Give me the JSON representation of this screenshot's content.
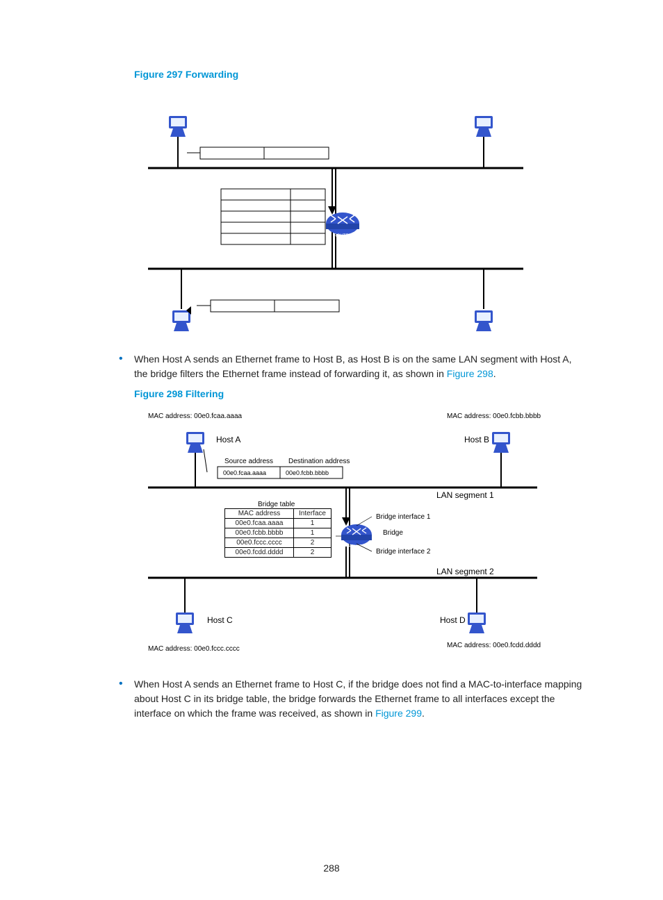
{
  "figure297": {
    "title": "Figure 297 Forwarding"
  },
  "para1": {
    "text_a": "When Host A sends an Ethernet frame to Host B, as Host B is on the same LAN segment with Host A, the bridge filters the Ethernet frame instead of forwarding it, as shown in ",
    "link": "Figure 298",
    "tail": "."
  },
  "figure298": {
    "title": "Figure 298 Filtering",
    "hostA_mac_label": "MAC address: 00e0.fcaa.aaaa",
    "hostA": "Host A",
    "hostB_mac_label": "MAC address: 00e0.fcbb.bbbb",
    "hostB": "Host B",
    "src_label": "Source address",
    "dst_label": "Destination address",
    "src_mac": "00e0.fcaa.aaaa",
    "dst_mac": "00e0.fcbb.bbbb",
    "lan1": "LAN segment 1",
    "lan2": "LAN segment 2",
    "bridge_table_label": "Bridge table",
    "col_mac": "MAC address",
    "col_if": "Interface",
    "rows": [
      {
        "mac": "00e0.fcaa.aaaa",
        "if": "1"
      },
      {
        "mac": "00e0.fcbb.bbbb",
        "if": "1"
      },
      {
        "mac": "00e0.fccc.cccc",
        "if": "2"
      },
      {
        "mac": "00e0.fcdd.dddd",
        "if": "2"
      }
    ],
    "bridge_if1": "Bridge interface 1",
    "bridge": "Bridge",
    "bridge_if2": "Bridge interface 2",
    "hostC": "Host C",
    "hostC_mac_label": "MAC address: 00e0.fccc.cccc",
    "hostD": "Host D",
    "hostD_mac_label": "MAC address: 00e0.fcdd.dddd"
  },
  "para2": {
    "text_a": "When Host A sends an Ethernet frame to Host C, if the bridge does not find a MAC-to-interface mapping about Host C in its bridge table, the bridge forwards the Ethernet frame to all interfaces except the interface on which the frame was received, as shown in ",
    "link": "Figure 299",
    "tail": "."
  },
  "pagenum": "288"
}
